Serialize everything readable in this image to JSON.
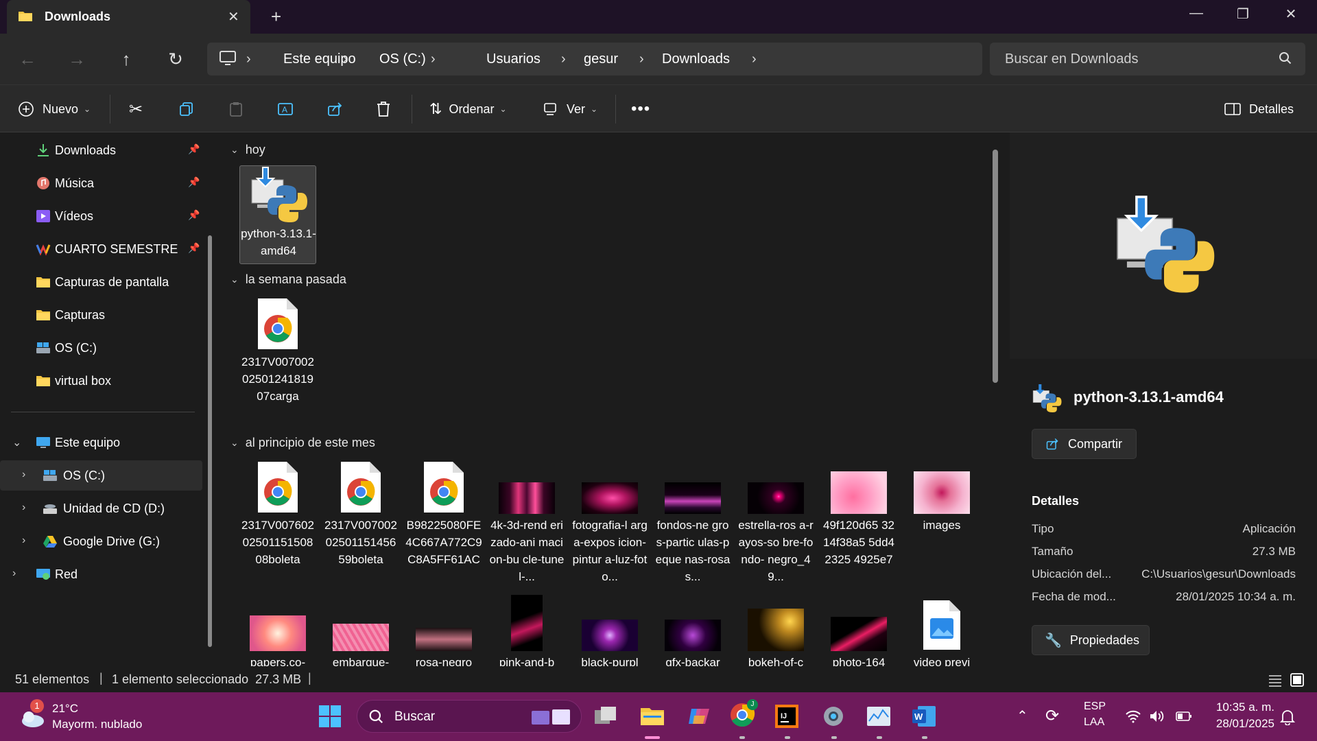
{
  "window": {
    "tab_title": "Downloads",
    "controls": [
      "minimize",
      "maximize",
      "close"
    ]
  },
  "breadcrumbs": [
    "Este equipo",
    "OS (C:)",
    "Usuarios",
    "gesur",
    "Downloads"
  ],
  "search": {
    "placeholder": "Buscar en Downloads"
  },
  "toolbar": {
    "new_label": "Nuevo",
    "sort_label": "Ordenar",
    "view_label": "Ver",
    "details_label": "Detalles"
  },
  "sidebar": {
    "quick_access": [
      {
        "label": "Downloads",
        "icon": "download-icon",
        "pinned": true
      },
      {
        "label": "Música",
        "icon": "music-icon",
        "pinned": true
      },
      {
        "label": "Vídeos",
        "icon": "videos-icon",
        "pinned": true
      },
      {
        "label": "CUARTO SEMESTRE",
        "icon": "folder-colored-icon",
        "pinned": true
      },
      {
        "label": "Capturas de pantalla",
        "icon": "folder-icon",
        "pinned": false
      },
      {
        "label": "Capturas",
        "icon": "folder-icon",
        "pinned": false
      },
      {
        "label": "OS (C:)",
        "icon": "drive-icon",
        "pinned": false
      },
      {
        "label": "virtual box",
        "icon": "folder-icon",
        "pinned": false
      }
    ],
    "tree": [
      {
        "label": "Este equipo",
        "icon": "computer-icon"
      },
      {
        "label": "OS (C:)",
        "icon": "drive-icon"
      },
      {
        "label": "Unidad de CD (D:)",
        "icon": "cd-drive-icon"
      },
      {
        "label": "Google Drive (G:)",
        "icon": "google-drive-icon"
      },
      {
        "label": "Red",
        "icon": "network-icon"
      }
    ]
  },
  "groups": [
    {
      "title": "hoy",
      "files": [
        {
          "name": "python-3.13.1-amd64",
          "kind": "python-installer"
        }
      ]
    },
    {
      "title": "la semana pasada",
      "files": [
        {
          "name": "2317V0070020250124181907carga",
          "kind": "chrome-doc"
        }
      ]
    },
    {
      "title": "al principio de este mes",
      "files": [
        {
          "name": "2317V0076020250115150808boleta",
          "kind": "chrome-doc"
        },
        {
          "name": "2317V0070020250115145659boleta",
          "kind": "chrome-doc"
        },
        {
          "name": "B98225080FE4C667A772C9C8A5FF61AC",
          "kind": "chrome-doc"
        },
        {
          "name": "4k-3d-renderizado-animacion-bucle-tunel-...",
          "kind": "image-waves"
        },
        {
          "name": "fotografia-larga-exposicion-pintura-luz-foto...",
          "kind": "image-lightpaint"
        },
        {
          "name": "fondos-negros-particulas-pequenas-rosas...",
          "kind": "image-particles"
        },
        {
          "name": "estrella-rosa-rayos-sobre-fondo-negro_49...",
          "kind": "image-star"
        },
        {
          "name": "49f120d653214f38a55dd423254925e7",
          "kind": "image-gradient"
        },
        {
          "name": "images",
          "kind": "image-pinkblur"
        }
      ]
    }
  ],
  "partial_row": [
    "papers.co-",
    "embarque-",
    "rosa-negro",
    "pink-and-b",
    "black-purpl",
    "gfx-backar",
    "bokeh-of-c",
    "photo-164",
    "video previ"
  ],
  "details_pane": {
    "name": "python-3.13.1-amd64",
    "share_label": "Compartir",
    "heading": "Detalles",
    "properties": [
      {
        "key": "Tipo",
        "value": "Aplicación"
      },
      {
        "key": "Tamaño",
        "value": "27.3 MB"
      },
      {
        "key": "Ubicación del...",
        "value": "C:\\Usuarios\\gesur\\Downloads"
      },
      {
        "key": "Fecha de mod...",
        "value": "28/01/2025 10:34 a. m."
      }
    ],
    "properties_label": "Propiedades"
  },
  "status": {
    "count": "51 elementos",
    "selection": "1 elemento seleccionado  27.3 MB"
  },
  "taskbar": {
    "weather_temp": "21°C",
    "weather_desc": "Mayorm. nublado",
    "weather_badge": "1",
    "search_label": "Buscar",
    "lang_top": "ESP",
    "lang_bottom": "LAA",
    "time": "10:35 a. m.",
    "date": "28/01/2025"
  },
  "colors": {
    "taskbar": "#6e1a5b",
    "titlebar": "#1e1226",
    "accent": "#4cc2ff"
  }
}
